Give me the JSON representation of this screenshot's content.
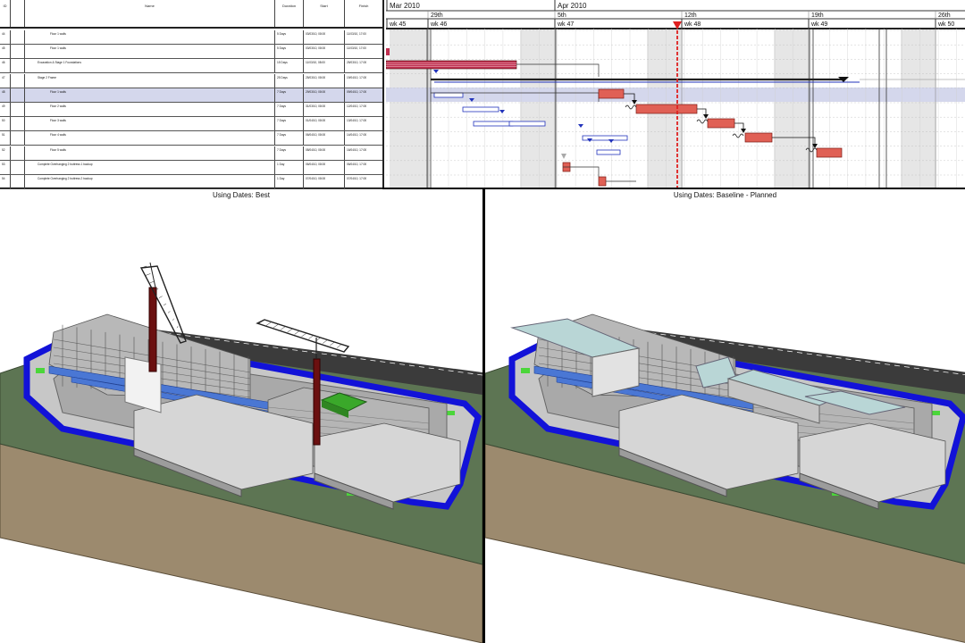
{
  "gantt": {
    "columns": [
      "ID",
      "",
      "Name",
      "Duration",
      "Start",
      "Finish"
    ],
    "rows": [
      {
        "id": "44",
        "mode": "",
        "name": "Floor 1 walls",
        "duration": "5 Days",
        "start": "03/03/10, 08:00",
        "finish": "11/03/10, 17:00",
        "selected": false
      },
      {
        "id": "45",
        "mode": "",
        "name": "Floor 1 walls",
        "duration": "5 Days",
        "start": "03/03/10, 08:00",
        "finish": "11/03/10, 17:00",
        "selected": false
      },
      {
        "id": "46",
        "mode": "",
        "name": "Excavation & Stage 1 Foundations",
        "duration": "15 Days",
        "start": "11/03/10, 08:00",
        "finish": "25/03/10, 17:00",
        "selected": false
      },
      {
        "id": "47",
        "mode": "",
        "name": "Stage 2 Frame",
        "duration": "25 Days",
        "start": "25/03/10, 08:00",
        "finish": "19/04/10, 17:00",
        "selected": false
      },
      {
        "id": "48",
        "mode": "",
        "name": "Floor 1 walls",
        "duration": "7 Days",
        "start": "29/03/10, 08:00",
        "finish": "09/04/10, 17:00",
        "selected": true
      },
      {
        "id": "49",
        "mode": "",
        "name": "Floor 2 walls",
        "duration": "7 Days",
        "start": "31/03/10, 08:00",
        "finish": "12/04/10, 17:00",
        "selected": false
      },
      {
        "id": "50",
        "mode": "",
        "name": "Floor 3 walls",
        "duration": "7 Days",
        "start": "01/04/10, 08:00",
        "finish": "13/04/10, 17:00",
        "selected": false
      },
      {
        "id": "51",
        "mode": "",
        "name": "Floor 4 walls",
        "duration": "7 Days",
        "start": "06/04/10, 08:00",
        "finish": "14/04/10, 17:00",
        "selected": false
      },
      {
        "id": "52",
        "mode": "",
        "name": "Floor 5 walls",
        "duration": "7 Days",
        "start": "08/04/10, 08:00",
        "finish": "16/04/10, 17:00",
        "selected": false
      },
      {
        "id": "53",
        "mode": "",
        "name": "Complete Overhanging 2 buttress 1 backup",
        "duration": "1 Day",
        "start": "06/04/10, 08:00",
        "finish": "06/04/10, 17:00",
        "selected": false
      },
      {
        "id": "54",
        "mode": "",
        "name": "Complete Overhanging 2 buttress 2 backup",
        "duration": "1 Day",
        "start": "07/04/10, 08:00",
        "finish": "07/04/10, 17:00",
        "selected": false
      }
    ],
    "months": [
      "Mar 2010",
      "Apr 2010"
    ],
    "days": [
      "29th",
      "5th",
      "12th",
      "19th",
      "26th"
    ],
    "weeks": [
      "wk 45",
      "wk 46",
      "wk 47",
      "wk 48",
      "wk 49",
      "wk 50"
    ]
  },
  "views": {
    "left_label": "Using Dates: Best",
    "right_label": "Using Dates: Baseline - Planned"
  },
  "colors": {
    "task_bar": "#e06055",
    "baseline_bar": "#2233bb",
    "summary_bar": "#c03050",
    "current_date_line": "#e02020",
    "site_boundary": "#1212d8",
    "grass": "#5d7553",
    "soil": "#9c8a6e",
    "crane": "#6b1010",
    "structure_highlight": "#3aa82a"
  }
}
